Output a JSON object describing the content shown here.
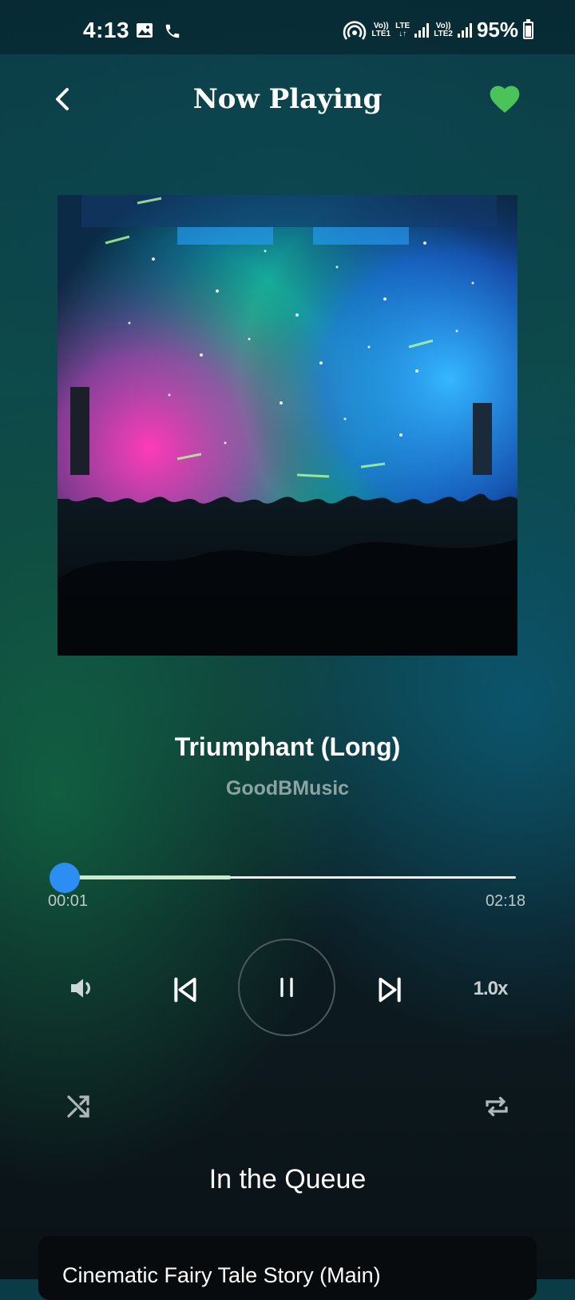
{
  "status_bar": {
    "time": "4:13",
    "lte1": [
      "Vo))",
      "LTE1"
    ],
    "lte_arrows": [
      "LTE",
      "↓↑"
    ],
    "lte2": [
      "Vo))",
      "LTE2"
    ],
    "battery": "95%"
  },
  "header": {
    "title": "Now Playing",
    "accent_color": "#4cc35a"
  },
  "track": {
    "title": "Triumphant (Long)",
    "artist": "GoodBMusic"
  },
  "progress": {
    "elapsed": "00:01",
    "duration": "02:18",
    "buffered_fraction": 0.37,
    "played_fraction": 0.01,
    "thumb_color": "#2c8df2"
  },
  "controls": {
    "speed": "1.0x"
  },
  "queue": {
    "heading": "In the Queue",
    "items": [
      {
        "title": "Cinematic Fairy Tale Story (Main)"
      }
    ]
  }
}
